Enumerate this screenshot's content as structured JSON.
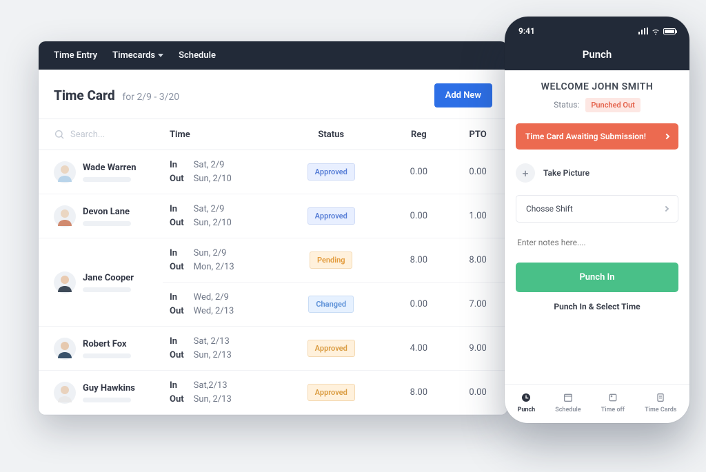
{
  "desktop": {
    "nav": {
      "time_entry": "Time Entry",
      "timecards": "Timecards",
      "schedule": "Schedule"
    },
    "header": {
      "title": "Time Card",
      "range": "for 2/9 - 3/20",
      "add_button": "Add New"
    },
    "columns": {
      "search_placeholder": "Search...",
      "time": "Time",
      "status": "Status",
      "reg": "Reg",
      "pto": "PTO"
    },
    "time_labels": {
      "in": "In",
      "out": "Out"
    },
    "rows": [
      {
        "name": "Wade Warren",
        "in": "Sat, 2/9",
        "out": "Sun, 2/10",
        "status": "Approved",
        "status_class": "b-approved-blue",
        "reg": "0.00",
        "pto": "0.00",
        "skin": "#ead6c2",
        "shirt": "#b9d4ea"
      },
      {
        "name": "Devon Lane",
        "in": "Sat, 2/9",
        "out": "Sun, 2/10",
        "status": "Approved",
        "status_class": "b-approved-blue",
        "reg": "0.00",
        "pto": "1.00",
        "skin": "#ead6c2",
        "shirt": "#d08a6f"
      },
      {
        "name": "Jane Cooper",
        "in": "Sun, 2/9",
        "out": "Mon, 2/13",
        "status": "Pending",
        "status_class": "b-pending",
        "reg": "8.00",
        "pto": "8.00",
        "skin": "#e9cab0",
        "shirt": "#3e4a58"
      },
      {
        "name": "Jane Cooper",
        "in": "Wed, 2/9",
        "out": "Wed, 2/13",
        "status": "Changed",
        "status_class": "b-changed",
        "reg": "0.00",
        "pto": "7.00",
        "skin": "#e9cab0",
        "shirt": "#3e4a58",
        "merge_down": true
      },
      {
        "name": "Robert Fox",
        "in": "Sat, 2/13",
        "out": "Sun, 2/13",
        "status": "Approved",
        "status_class": "b-approved-amb",
        "reg": "4.00",
        "pto": "9.00",
        "skin": "#e6c9af",
        "shirt": "#39526b"
      },
      {
        "name": "Guy Hawkins",
        "in": "Sat,2/13",
        "out": "Sun, 2/13",
        "status": "Approved",
        "status_class": "b-approved-amb",
        "reg": "8.00",
        "pto": "0.00",
        "skin": "#e9d2bd",
        "shirt": "#e9e9ea"
      }
    ]
  },
  "phone": {
    "clock": "9:41",
    "title": "Punch",
    "welcome": "WELCOME JOHN SMITH",
    "status_label": "Status:",
    "status_value": "Punched Out",
    "alert": "Time Card Awaiting Submission!",
    "take_picture": "Take Picture",
    "choose_shift": "Chosse Shift",
    "notes_placeholder": "Enter notes here....",
    "punch_in": "Punch In",
    "punch_select": "Punch In & Select Time",
    "tabs": {
      "punch": "Punch",
      "schedule": "Schedule",
      "timeoff": "Time off",
      "timecards": "Time Cards"
    }
  }
}
